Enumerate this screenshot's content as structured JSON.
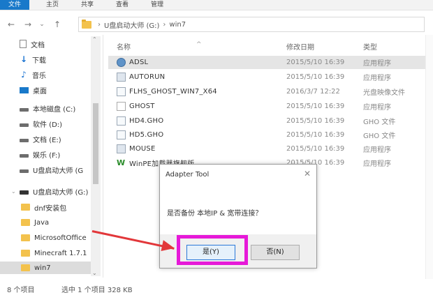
{
  "ribbon": {
    "tabs": [
      "文件",
      "主页",
      "共享",
      "查看",
      "管理"
    ]
  },
  "address": {
    "back": "←",
    "forward": "→",
    "recent": "⌄",
    "up": "↑",
    "crumb_sep1": "›",
    "crumb_sep2": "›",
    "path": [
      "U盘启动大师 (G:)",
      "win7"
    ]
  },
  "nav": {
    "quick": [
      {
        "label": "文档",
        "icon": "document-icon"
      },
      {
        "label": "下载",
        "icon": "download-icon"
      },
      {
        "label": "音乐",
        "icon": "music-icon"
      },
      {
        "label": "桌面",
        "icon": "desktop-icon"
      }
    ],
    "drives": [
      {
        "label": "本地磁盘 (C:)"
      },
      {
        "label": "软件 (D:)"
      },
      {
        "label": "文档 (E:)"
      },
      {
        "label": "娱乐 (F:)"
      },
      {
        "label": "U盘启动大师 (G"
      }
    ],
    "usb": {
      "label": "U盘启动大师 (G:)"
    },
    "folders": [
      {
        "label": "dnf安装包"
      },
      {
        "label": "Java"
      },
      {
        "label": "MicrosoftOffice"
      },
      {
        "label": "Minecraft 1.7.1"
      },
      {
        "label": "win7"
      }
    ],
    "scroll_up": "⌃",
    "scroll_down": "⌄",
    "chevron": "›",
    "chevron_open": "⌄"
  },
  "columns": {
    "name": "名称",
    "date": "修改日期",
    "type": "类型",
    "sort_arrow": "^"
  },
  "files": [
    {
      "name": "ADSL",
      "date": "2015/5/10 16:39",
      "type": "应用程序",
      "icon": "adsl-app-icon"
    },
    {
      "name": "AUTORUN",
      "date": "2015/5/10 16:39",
      "type": "应用程序",
      "icon": "app-icon"
    },
    {
      "name": "FLHS_GHOST_WIN7_X64",
      "date": "2016/3/7 12:22",
      "type": "光盘映像文件",
      "icon": "disc-image-icon"
    },
    {
      "name": "GHOST",
      "date": "2015/5/10 16:39",
      "type": "应用程序",
      "icon": "ghost-app-icon"
    },
    {
      "name": "HD4.GHO",
      "date": "2015/5/10 16:39",
      "type": "GHO 文件",
      "icon": "file-icon"
    },
    {
      "name": "HD5.GHO",
      "date": "2015/5/10 16:39",
      "type": "GHO 文件",
      "icon": "file-icon"
    },
    {
      "name": "MOUSE",
      "date": "2015/5/10 16:39",
      "type": "应用程序",
      "icon": "app-icon"
    },
    {
      "name": "WinPE加载器旗舰版",
      "date": "2015/5/10 16:39",
      "type": "应用程序",
      "icon": "winpe-app-icon"
    }
  ],
  "status": {
    "count": "8 个项目",
    "selected": "选中 1 个项目  328 KB"
  },
  "dialog": {
    "title": "Adapter Tool",
    "close": "✕",
    "message": "是否备份 本地IP & 宽带连接？",
    "yes": "是(Y)",
    "no": "否(N)"
  },
  "colors": {
    "accent": "#1979ca",
    "highlight": "#e619d8",
    "arrow": "#e2373a"
  }
}
